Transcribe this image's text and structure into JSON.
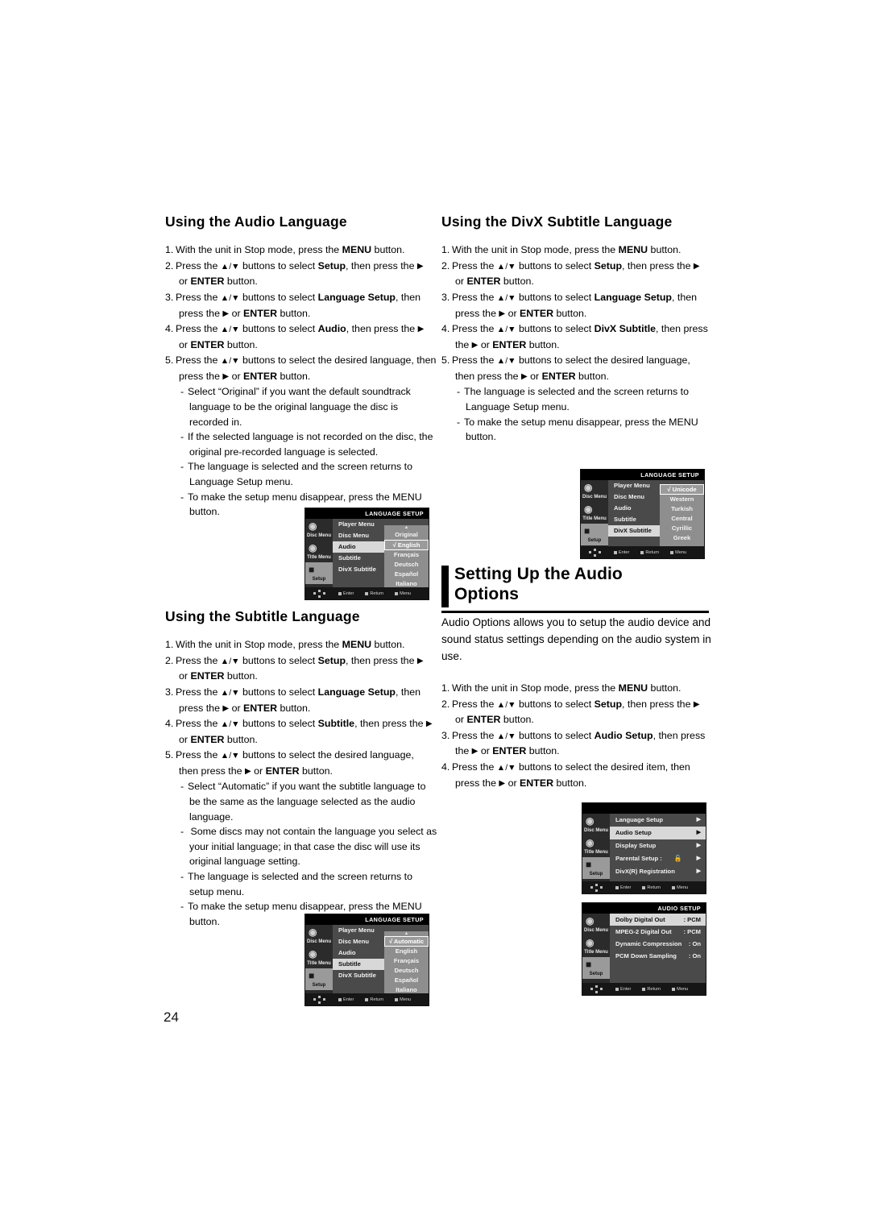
{
  "page": {
    "number": "24"
  },
  "sections": {
    "audio_language": {
      "heading": "Using the Audio Language",
      "steps": [
        {
          "n": "1.",
          "html": "With the unit in Stop mode, press the <b>MENU</b> button."
        },
        {
          "n": "2.",
          "html": "Press the <span class=\"ud\">▲/▼</span> buttons to select <b>Setup</b>, then press the <span class=\"arr\">▶</span><br>or <b>ENTER</b> button."
        },
        {
          "n": "3.",
          "html": "Press the <span class=\"ud\">▲/▼</span> buttons to select <b>Language Setup</b>, then<br>press the <span class=\"arr\">▶</span> or <b>ENTER</b> button."
        },
        {
          "n": "4.",
          "html": "Press the <span class=\"ud\">▲/▼</span> buttons to select <b>Audio</b>, then press the <span class=\"arr\">▶</span><br>or <b>ENTER</b> button."
        },
        {
          "n": "5.",
          "html": "Press the <span class=\"ud\">▲/▼</span> buttons to select the desired language, then<br>press the <span class=\"arr\">▶</span> or <b>ENTER</b> button."
        }
      ],
      "notes": [
        "Select “Original” if you want the default soundtrack language to be the original language the disc is recorded in.",
        "If the selected language is not recorded on the disc, the original pre-recorded language is selected.",
        "The language is selected and the screen returns to Language Setup menu.",
        "To make the setup menu disappear, press the MENU button."
      ]
    },
    "subtitle_language": {
      "heading": "Using the Subtitle Language",
      "steps": [
        {
          "n": "1.",
          "html": "With the unit in Stop mode, press the <b>MENU</b> button."
        },
        {
          "n": "2.",
          "html": "Press the <span class=\"ud\">▲/▼</span> buttons to select <b>Setup</b>, then press the <span class=\"arr\">▶</span><br>or <b>ENTER</b> button."
        },
        {
          "n": "3.",
          "html": "Press the <span class=\"ud\">▲/▼</span> buttons to select <b>Language Setup</b>, then<br>press the <span class=\"arr\">▶</span> or <b>ENTER</b> button."
        },
        {
          "n": "4.",
          "html": "Press the <span class=\"ud\">▲/▼</span> buttons to select <b>Subtitle</b>, then press the <span class=\"arr\">▶</span><br>or <b>ENTER</b> button."
        },
        {
          "n": "5.",
          "html": "Press the <span class=\"ud\">▲/▼</span> buttons to select the desired  language,<br>then press the <span class=\"arr\">▶</span> or <b>ENTER</b> button."
        }
      ],
      "notes": [
        "Select “Automatic” if you want the subtitle  language to be the same as the language selected as the audio language.",
        " Some discs may not contain the language you select as your initial language; in that case the disc will use its original language setting.",
        "The language is selected and the screen returns to setup menu.",
        "To make the setup menu disappear, press the MENU button."
      ]
    },
    "divx_subtitle_language": {
      "heading": "Using the DivX Subtitle Language",
      "steps": [
        {
          "n": "1.",
          "html": "With the unit in Stop mode, press the <b>MENU</b> button."
        },
        {
          "n": "2.",
          "html": "Press the <span class=\"ud\">▲/▼</span> buttons to select <b>Setup</b>, then press the <span class=\"arr\">▶</span><br>or <b>ENTER</b> button."
        },
        {
          "n": "3.",
          "html": "Press the <span class=\"ud\">▲/▼</span> buttons to select <b>Language Setup</b>, then<br>press the <span class=\"arr\">▶</span> or <b>ENTER</b> button."
        },
        {
          "n": "4.",
          "html": "Press the <span class=\"ud\">▲/▼</span> buttons to select <b>DivX Subtitle</b>, then press<br>the <span class=\"arr\">▶</span> or <b>ENTER</b> button."
        },
        {
          "n": "5.",
          "html": "Press the <span class=\"ud\">▲/▼</span> buttons to select the desired  language,<br>then press the <span class=\"arr\">▶</span> or <b>ENTER</b> button."
        }
      ],
      "notes": [
        "The language is selected and the screen returns to Language Setup menu.",
        "To make the setup menu disappear, press the MENU button."
      ]
    },
    "audio_options": {
      "heading_line1": "Setting Up the Audio",
      "heading_line2": "Options",
      "intro": "Audio Options allows you to setup the audio device and sound status settings depending on the audio system in use.",
      "steps": [
        {
          "n": "1.",
          "html": "With the unit in Stop mode, press the <b>MENU</b> button."
        },
        {
          "n": "2.",
          "html": "Press the <span class=\"ud\">▲/▼</span> buttons to select <b>Setup</b>, then press the <span class=\"arr\">▶</span><br>or <b>ENTER</b> button."
        },
        {
          "n": "3.",
          "html": "Press the <span class=\"ud\">▲/▼</span> buttons to select <b>Audio Setup</b>, then press<br>the <span class=\"arr\">▶</span> or <b>ENTER</b> button."
        },
        {
          "n": "4.",
          "html": "Press the <span class=\"ud\">▲/▼</span> buttons to select the desired item, then<br>press the <span class=\"arr\">▶</span> or <b>ENTER</b> button."
        }
      ]
    }
  },
  "osd_common": {
    "tabs": [
      {
        "label": "Disc Menu",
        "icon": "disc-menu-icon"
      },
      {
        "label": "Title Menu",
        "icon": "title-menu-icon"
      },
      {
        "label": "Setup",
        "icon": "setup-icon"
      }
    ],
    "bottom_keys": [
      "Enter",
      "Return",
      "Menu"
    ]
  },
  "osd_audio_language": {
    "title": "LANGUAGE SETUP",
    "selected_tab": "Setup",
    "menu": [
      "Player Menu",
      "Disc Menu",
      "Audio",
      "Subtitle",
      "DivX Subtitle"
    ],
    "menu_selected": "Audio",
    "options": [
      "Original",
      "English",
      "Français",
      "Deutsch",
      "Español",
      "Italiano"
    ],
    "option_selected": "English",
    "check": "√",
    "scroll_up": "▲",
    "scroll_down": "▼"
  },
  "osd_subtitle_language": {
    "title": "LANGUAGE SETUP",
    "selected_tab": "Setup",
    "menu": [
      "Player Menu",
      "Disc Menu",
      "Audio",
      "Subtitle",
      "DivX Subtitle"
    ],
    "menu_selected": "Subtitle",
    "options": [
      "Automatic",
      "English",
      "Français",
      "Deutsch",
      "Español",
      "Italiano"
    ],
    "option_selected": "Automatic",
    "check": "√",
    "scroll_up": "▲",
    "scroll_down": "▼"
  },
  "osd_divx_subtitle": {
    "title": "LANGUAGE SETUP",
    "selected_tab": "Setup",
    "menu": [
      "Player Menu",
      "Disc Menu",
      "Audio",
      "Subtitle",
      "DivX Subtitle"
    ],
    "menu_selected": "DivX Subtitle",
    "options": [
      "Unicode",
      "Western",
      "Turkish",
      "Central",
      "Cyrillic",
      "Greek"
    ],
    "option_selected": "Unicode",
    "check": "√"
  },
  "osd_setup_menu": {
    "title": "",
    "selected_tab": "Setup",
    "items": [
      {
        "label": "Language Setup",
        "value": "",
        "arrow": "▶"
      },
      {
        "label": "Audio Setup",
        "value": "",
        "arrow": "▶"
      },
      {
        "label": "Display Setup",
        "value": "",
        "arrow": "▶"
      },
      {
        "label": "Parental Setup :",
        "value": "lock-open-icon",
        "arrow": "▶"
      },
      {
        "label": "DivX(R) Registration",
        "value": "",
        "arrow": "▶"
      }
    ],
    "selected": "Audio Setup"
  },
  "osd_audio_setup": {
    "title": "AUDIO SETUP",
    "selected_tab": "Setup",
    "items": [
      {
        "label": "Dolby Digital Out",
        "value": ": PCM"
      },
      {
        "label": "MPEG-2 Digital Out",
        "value": ": PCM"
      },
      {
        "label": "Dynamic Compression",
        "value": ": On"
      },
      {
        "label": "PCM Down Sampling",
        "value": ": On"
      }
    ],
    "selected": "Dolby Digital Out"
  }
}
